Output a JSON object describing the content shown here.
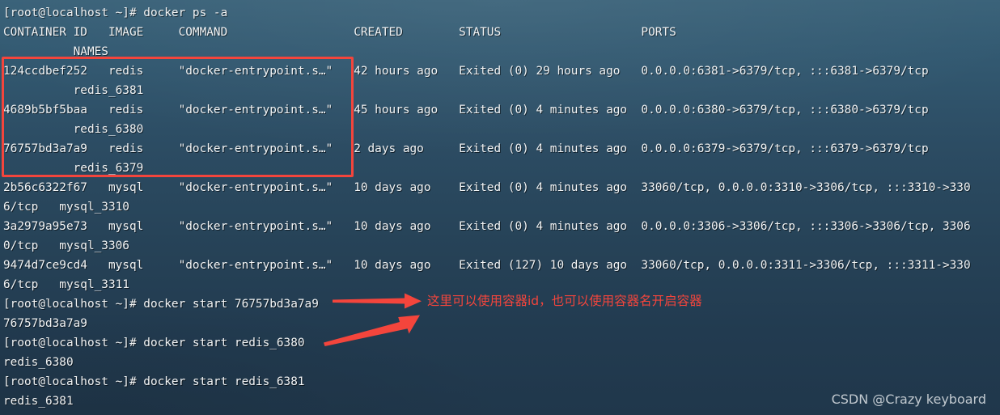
{
  "terminal": {
    "prompt": "[root@localhost ~]#",
    "background_color": "#2c4c63",
    "text_color": "#f2f4f5",
    "accent_color": "#f4453c",
    "lines": [
      "[root@localhost ~]# docker ps -a",
      "CONTAINER ID   IMAGE     COMMAND                  CREATED        STATUS                    PORTS",
      "          NAMES",
      "124ccdbef252   redis     \"docker-entrypoint.s…\"   42 hours ago   Exited (0) 29 hours ago   0.0.0.0:6381->6379/tcp, :::6381->6379/tcp",
      "          redis_6381",
      "4689b5bf5baa   redis     \"docker-entrypoint.s…\"   45 hours ago   Exited (0) 4 minutes ago  0.0.0.0:6380->6379/tcp, :::6380->6379/tcp",
      "          redis_6380",
      "76757bd3a7a9   redis     \"docker-entrypoint.s…\"   2 days ago     Exited (0) 4 minutes ago  0.0.0.0:6379->6379/tcp, :::6379->6379/tcp",
      "          redis_6379",
      "2b56c6322f67   mysql     \"docker-entrypoint.s…\"   10 days ago    Exited (0) 4 minutes ago  33060/tcp, 0.0.0.0:3310->3306/tcp, :::3310->330",
      "6/tcp   mysql_3310",
      "3a2979a95e73   mysql     \"docker-entrypoint.s…\"   10 days ago    Exited (0) 4 minutes ago  0.0.0.0:3306->3306/tcp, :::3306->3306/tcp, 3306",
      "0/tcp   mysql_3306",
      "9474d7ce9cd4   mysql     \"docker-entrypoint.s…\"   10 days ago    Exited (127) 10 days ago  33060/tcp, 0.0.0.0:3311->3306/tcp, :::3311->330",
      "6/tcp   mysql_3311",
      "[root@localhost ~]# docker start 76757bd3a7a9",
      "76757bd3a7a9",
      "[root@localhost ~]# docker start redis_6380",
      "redis_6380",
      "[root@localhost ~]# docker start redis_6381",
      "redis_6381"
    ],
    "commands": [
      "docker ps -a",
      "docker start 76757bd3a7a9",
      "docker start redis_6380",
      "docker start redis_6381"
    ],
    "table": {
      "headers": [
        "CONTAINER ID",
        "IMAGE",
        "COMMAND",
        "CREATED",
        "STATUS",
        "PORTS",
        "NAMES"
      ],
      "rows": [
        {
          "container_id": "124ccdbef252",
          "image": "redis",
          "command": "\"docker-entrypoint.s…\"",
          "created": "42 hours ago",
          "status": "Exited (0) 29 hours ago",
          "ports": "0.0.0.0:6381->6379/tcp, :::6381->6379/tcp",
          "names": "redis_6381",
          "highlighted": true
        },
        {
          "container_id": "4689b5bf5baa",
          "image": "redis",
          "command": "\"docker-entrypoint.s…\"",
          "created": "45 hours ago",
          "status": "Exited (0) 4 minutes ago",
          "ports": "0.0.0.0:6380->6379/tcp, :::6380->6379/tcp",
          "names": "redis_6380",
          "highlighted": true
        },
        {
          "container_id": "76757bd3a7a9",
          "image": "redis",
          "command": "\"docker-entrypoint.s…\"",
          "created": "2 days ago",
          "status": "Exited (0) 4 minutes ago",
          "ports": "0.0.0.0:6379->6379/tcp, :::6379->6379/tcp",
          "names": "redis_6379",
          "highlighted": true
        },
        {
          "container_id": "2b56c6322f67",
          "image": "mysql",
          "command": "\"docker-entrypoint.s…\"",
          "created": "10 days ago",
          "status": "Exited (0) 4 minutes ago",
          "ports": "33060/tcp, 0.0.0.0:3310->3306/tcp, :::3310->3306/tcp",
          "names": "mysql_3310",
          "highlighted": false
        },
        {
          "container_id": "3a2979a95e73",
          "image": "mysql",
          "command": "\"docker-entrypoint.s…\"",
          "created": "10 days ago",
          "status": "Exited (0) 4 minutes ago",
          "ports": "0.0.0.0:3306->3306/tcp, :::3306->3306/tcp, 33060/tcp",
          "names": "mysql_3306",
          "highlighted": false
        },
        {
          "container_id": "9474d7ce9cd4",
          "image": "mysql",
          "command": "\"docker-entrypoint.s…\"",
          "created": "10 days ago",
          "status": "Exited (127) 10 days ago",
          "ports": "33060/tcp, 0.0.0.0:3311->3306/tcp, :::3311->3306/tcp",
          "names": "mysql_3311",
          "highlighted": false
        }
      ]
    },
    "outputs": [
      "76757bd3a7a9",
      "redis_6380",
      "redis_6381"
    ]
  },
  "annotation": {
    "text": "这里可以使用容器id，也可以使用容器名开启容器",
    "color": "#f4453c"
  },
  "watermark": {
    "text": "CSDN @Crazy keyboard"
  }
}
